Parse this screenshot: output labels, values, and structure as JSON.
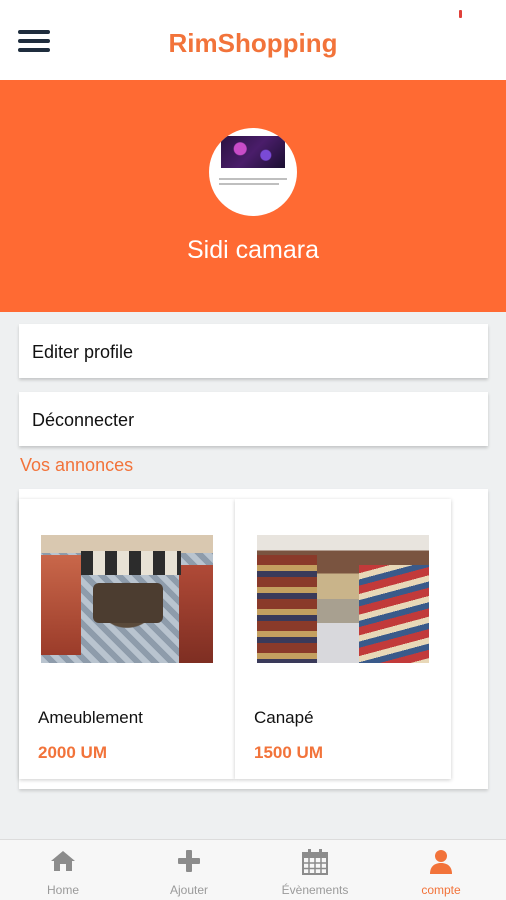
{
  "header": {
    "title": "RimShopping",
    "menu_icon": "hamburger-menu-icon"
  },
  "profile": {
    "name": "Sidi camara",
    "avatar_icon": "profile-picture"
  },
  "actions": {
    "edit_profile": "Editer profile",
    "logout": "Déconnecter"
  },
  "ads_section": {
    "title": "Vos annonces"
  },
  "ads": [
    {
      "name": "Ameublement",
      "price": "2000 UM"
    },
    {
      "name": "Canapé",
      "price": "1500 UM"
    }
  ],
  "nav": [
    {
      "label": "Home",
      "icon": "home-icon"
    },
    {
      "label": "Ajouter",
      "icon": "plus-icon"
    },
    {
      "label": "Évènements",
      "icon": "calendar-icon"
    },
    {
      "label": "compte",
      "icon": "user-icon",
      "active": true
    }
  ],
  "colors": {
    "accent": "#ff6a33",
    "accent_text": "#f2733a",
    "nav_inactive": "#9a9a9a"
  }
}
